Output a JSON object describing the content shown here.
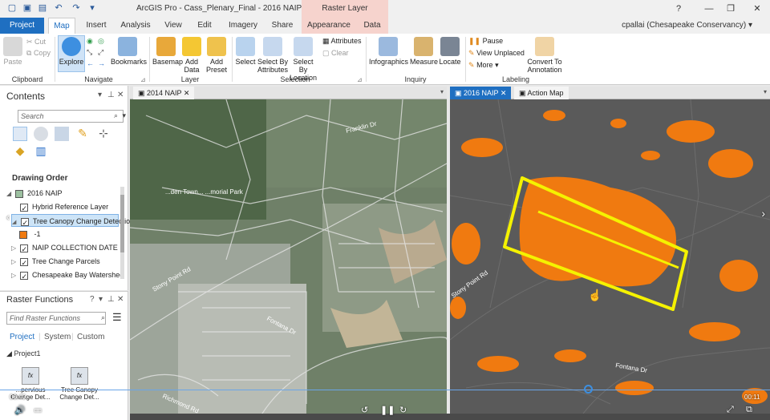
{
  "titlebar": {
    "title": "ArcGIS Pro - Cass_Plenary_Final - 2016 NAIP",
    "context_tab": "Raster Layer",
    "help": "?",
    "minimize": "—",
    "restore": "❐",
    "close": "✕"
  },
  "tabs": {
    "items": [
      "Project",
      "Map",
      "Insert",
      "Analysis",
      "View",
      "Edit",
      "Imagery",
      "Share",
      "Appearance",
      "Data"
    ],
    "active": "Map",
    "user": "cpallai (Chesapeake Conservancy) ▾"
  },
  "ribbon": {
    "clipboard": {
      "paste": "Paste",
      "cut": "Cut",
      "copy": "Copy",
      "label": "Clipboard"
    },
    "navigate": {
      "explore": "Explore",
      "bookmarks": "Bookmarks",
      "label": "Navigate"
    },
    "layer": {
      "basemap": "Basemap",
      "add_data_1": "Add",
      "add_data_2": "Data",
      "add_preset_1": "Add",
      "add_preset_2": "Preset",
      "label": "Layer"
    },
    "selection": {
      "select": "Select",
      "select_attr_1": "Select By",
      "select_attr_2": "Attributes",
      "select_loc_1": "Select By",
      "select_loc_2": "Location",
      "attributes": "Attributes",
      "clear": "Clear",
      "label": "Selection"
    },
    "inquiry": {
      "infographics": "Infographics",
      "measure": "Measure",
      "locate": "Locate",
      "label": "Inquiry"
    },
    "labeling": {
      "pause": "Pause",
      "view_unplaced": "View Unplaced",
      "more": "More",
      "convert_1": "Convert To",
      "convert_2": "Annotation",
      "label": "Labeling"
    }
  },
  "contents": {
    "title": "Contents",
    "search_placeholder": "Search",
    "drawing_order": "Drawing Order",
    "layers": [
      {
        "name": "2016 NAIP"
      },
      {
        "name": "Hybrid Reference Layer"
      },
      {
        "name": "Tree Canopy Change Detectio"
      },
      {
        "name": "-1"
      },
      {
        "name": "NAIP COLLECTION DATE"
      },
      {
        "name": "Tree Change Parcels"
      },
      {
        "name": "Chesapeake Bay Watershed"
      }
    ]
  },
  "raster_functions": {
    "title": "Raster Functions",
    "search_placeholder": "Find Raster Functions",
    "tabs": [
      "Project",
      "System",
      "Custom"
    ],
    "group": "Project1",
    "items": [
      {
        "line1": "...pervious",
        "line2": "Change Det..."
      },
      {
        "line1": "Tree Canopy",
        "line2": "Change Det..."
      }
    ]
  },
  "map_left": {
    "tab": "2014 NAIP",
    "roads": [
      "Franklin Dr",
      "Stony Point Rd",
      "Fontana Dr",
      "Richmond Rd"
    ],
    "park": "...den Town... ...morial Park"
  },
  "map_right": {
    "tab_active": "2016 NAIP",
    "tab_other": "Action Map",
    "roads": [
      "Stony Point Rd",
      "Fontana Dr"
    ]
  },
  "video": {
    "elapsed": "00:40",
    "remaining": "00:11"
  },
  "colors": {
    "accent": "#1f6fc1",
    "context": "#f6d3cd",
    "canopy": "#f07a10",
    "highlight": "#f5f200"
  }
}
